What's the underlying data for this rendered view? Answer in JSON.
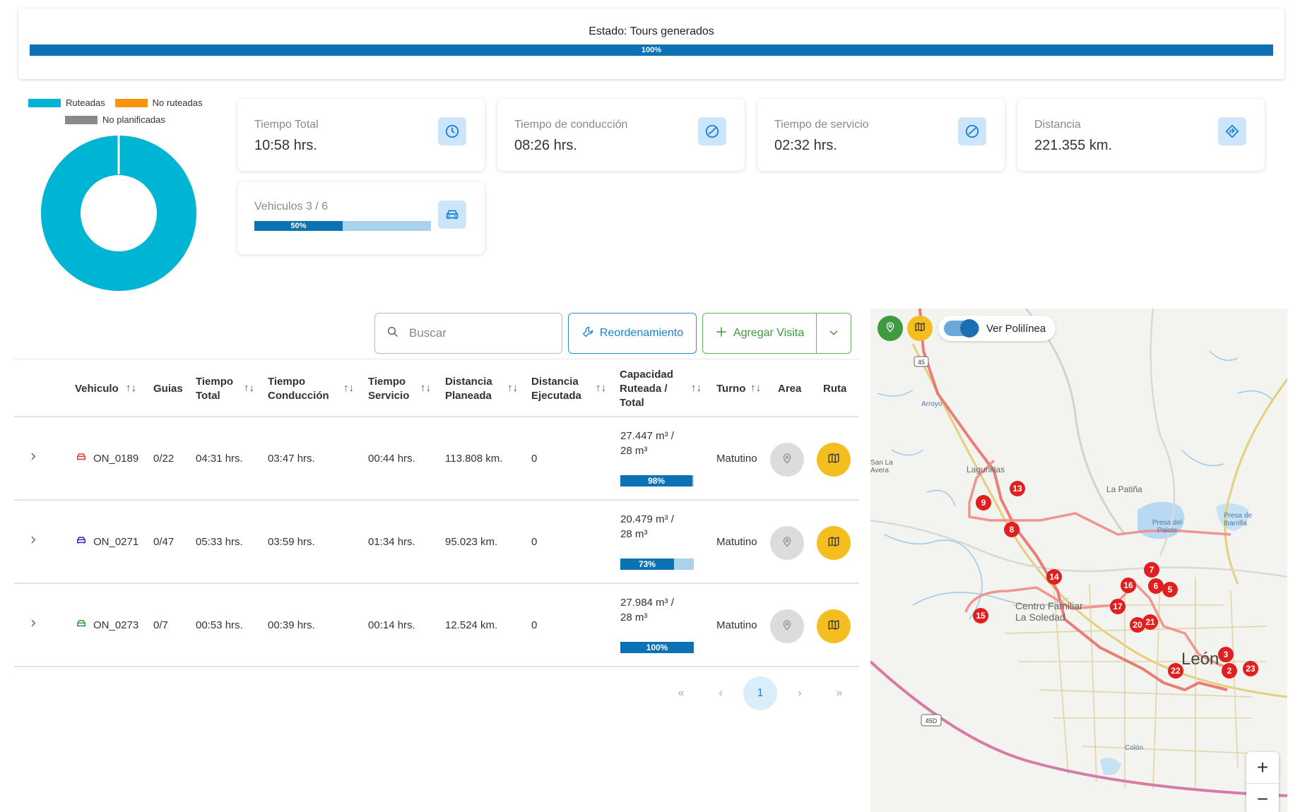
{
  "status": {
    "title": "Estado: Tours generados",
    "progress_label": "100%",
    "progress": 100
  },
  "legend": {
    "items": [
      {
        "label": "Ruteadas",
        "color": "#00b4d4"
      },
      {
        "label": "No ruteadas",
        "color": "#f7940c"
      },
      {
        "label": "No planificadas",
        "color": "#8a8a8a"
      }
    ]
  },
  "donut": {
    "ruteadas": 100,
    "no_ruteadas": 0,
    "no_planificadas": 0,
    "color": "#00b4d4"
  },
  "metrics": {
    "tiempo_total": {
      "label": "Tiempo Total",
      "value": "10:58 hrs.",
      "icon": "clock-icon"
    },
    "tiempo_conduccion": {
      "label": "Tiempo de conducción",
      "value": "08:26 hrs.",
      "icon": "pie-clock-icon"
    },
    "tiempo_servicio": {
      "label": "Tiempo de servicio",
      "value": "02:32 hrs.",
      "icon": "pie-clock-icon"
    },
    "distancia": {
      "label": "Distancia",
      "value": "221.355 km.",
      "icon": "direction-icon"
    },
    "vehiculos": {
      "label": "Vehiculos 3 / 6",
      "progress_label": "50%",
      "progress": 50,
      "icon": "car-icon"
    }
  },
  "toolbar": {
    "search_placeholder": "Buscar",
    "reorder_label": "Reordenamiento",
    "add_visit_label": "Agregar Visita"
  },
  "table": {
    "headers": {
      "vehiculo": "Vehiculo",
      "guias": "Guias",
      "tiempo_total_1": "Tiempo",
      "tiempo_total_2": "Total",
      "tiempo_conduccion_1": "Tiempo",
      "tiempo_conduccion_2": "Conducción",
      "tiempo_servicio_1": "Tiempo",
      "tiempo_servicio_2": "Servicio",
      "distancia_planeada_1": "Distancia",
      "distancia_planeada_2": "Planeada",
      "distancia_ejecutada_1": "Distancia",
      "distancia_ejecutada_2": "Ejecutada",
      "capacidad_1": "Capacidad",
      "capacidad_2": "Ruteada /",
      "capacidad_3": "Total",
      "turno": "Turno",
      "area": "Area",
      "ruta": "Ruta"
    },
    "rows": [
      {
        "vehiculo": "ON_0189",
        "car_color": "#e53935",
        "guias": "0/22",
        "tiempo_total": "04:31 hrs.",
        "tiempo_conduccion": "03:47 hrs.",
        "tiempo_servicio": "00:44 hrs.",
        "distancia_planeada": "113.808 km.",
        "distancia_ejecutada": "0",
        "capacidad_line1": "27.447 m³ /",
        "capacidad_line2": "28 m³",
        "capacidad_pct_label": "98%",
        "capacidad_pct": 98,
        "turno": "Matutino"
      },
      {
        "vehiculo": "ON_0271",
        "car_color": "#2b2bd6",
        "guias": "0/47",
        "tiempo_total": "05:33 hrs.",
        "tiempo_conduccion": "03:59 hrs.",
        "tiempo_servicio": "01:34 hrs.",
        "distancia_planeada": "95.023 km.",
        "distancia_ejecutada": "0",
        "capacidad_line1": "20.479 m³ /",
        "capacidad_line2": "28 m³",
        "capacidad_pct_label": "73%",
        "capacidad_pct": 73,
        "turno": "Matutino"
      },
      {
        "vehiculo": "ON_0273",
        "car_color": "#2e9a3e",
        "guias": "0/7",
        "tiempo_total": "00:53 hrs.",
        "tiempo_conduccion": "00:39 hrs.",
        "tiempo_servicio": "00:14 hrs.",
        "distancia_planeada": "12.524 km.",
        "distancia_ejecutada": "0",
        "capacidad_line1": "27.984 m³ /",
        "capacidad_line2": "28 m³",
        "capacidad_pct_label": "100%",
        "capacidad_pct": 100,
        "turno": "Matutino"
      }
    ]
  },
  "pagination": {
    "first": "«",
    "prev": "‹",
    "current": "1",
    "next": "›",
    "last": "»"
  },
  "map": {
    "toggle_label": "Ver Polilínea",
    "zoom_in": "+",
    "zoom_out": "−",
    "place_labels": [
      "Lagunillas",
      "La Patiña",
      "Presa del Palote",
      "Presa de Ibarrilla",
      "Centro Familiar",
      "La Soledad",
      "León",
      "Arroyo",
      "San La Avera",
      "Colón"
    ],
    "highway_labels": [
      "45",
      "45D"
    ],
    "stops": [
      "9",
      "13",
      "8",
      "14",
      "7",
      "16",
      "6",
      "5",
      "15",
      "17",
      "20",
      "21",
      "3",
      "22",
      "2",
      "23"
    ]
  }
}
